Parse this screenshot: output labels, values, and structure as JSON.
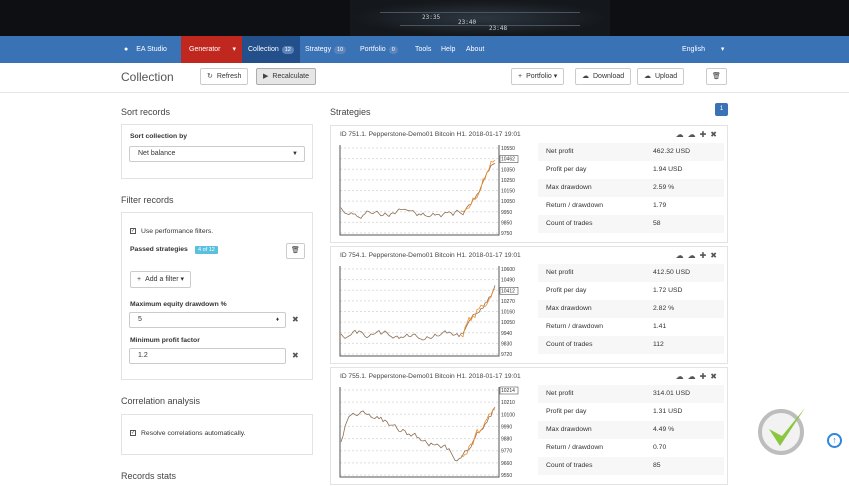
{
  "banner": {
    "times": [
      "23:35",
      "23:40",
      "23:48"
    ]
  },
  "nav": {
    "ea_studio": "EA Studio",
    "generator": "Generator",
    "collection": "Collection",
    "collection_count": "12",
    "strategy": "Strategy",
    "strategy_count": "10",
    "portfolio": "Portfolio",
    "portfolio_count": "0",
    "tools": "Tools",
    "help": "Help",
    "about": "About",
    "language": "English"
  },
  "page": {
    "title": "Collection",
    "refresh": "Refresh",
    "recalculate": "Recalculate",
    "portfolio": "Portfolio",
    "download": "Download",
    "upload": "Upload"
  },
  "sort": {
    "heading": "Sort records",
    "label": "Sort collection by",
    "value": "Net balance"
  },
  "filter": {
    "heading": "Filter records",
    "use_filters": "Use performance filters.",
    "passed_label": "Passed strategies",
    "passed_tag": "4 of 12",
    "add_filter": "Add a filter",
    "max_dd_label": "Maximum equity drawdown %",
    "max_dd_value": "5",
    "min_pf_label": "Minimum profit factor",
    "min_pf_value": "1.2"
  },
  "correlation": {
    "heading": "Correlation analysis",
    "resolve": "Resolve correlations automatically."
  },
  "records_stats": {
    "heading": "Records stats"
  },
  "strategies": {
    "heading": "Strategies",
    "page": "1",
    "stat_labels": [
      "Net profit",
      "Profit per day",
      "Max drawdown",
      "Return / drawdown",
      "Count of trades"
    ],
    "items": [
      {
        "title": "ID 751.1. Pepperstone-Demo01 Bitcoin H1. 2018-01-17 19:01",
        "stats": [
          "462.32 USD",
          "1.94 USD",
          "2.59 %",
          "1.79",
          "58"
        ],
        "axis": [
          "10550",
          "10462",
          "10350",
          "10250",
          "10150",
          "10050",
          "9950",
          "9850",
          "9750"
        ],
        "highlight": 1
      },
      {
        "title": "ID 754.1. Pepperstone-Demo01 Bitcoin H1. 2018-01-17 19:01",
        "stats": [
          "412.50 USD",
          "1.72 USD",
          "2.82 %",
          "1.41",
          "112"
        ],
        "axis": [
          "10600",
          "10490",
          "10412",
          "10270",
          "10160",
          "10050",
          "9940",
          "9830",
          "9720"
        ],
        "highlight": 2
      },
      {
        "title": "ID 755.1. Pepperstone-Demo01 Bitcoin H1. 2018-01-17 19:01",
        "stats": [
          "314.01 USD",
          "1.31 USD",
          "4.49 %",
          "0.70",
          "85"
        ],
        "axis": [
          "10214",
          "10210",
          "10100",
          "9990",
          "9880",
          "9770",
          "9660",
          "9550"
        ],
        "highlight": 0
      }
    ]
  }
}
